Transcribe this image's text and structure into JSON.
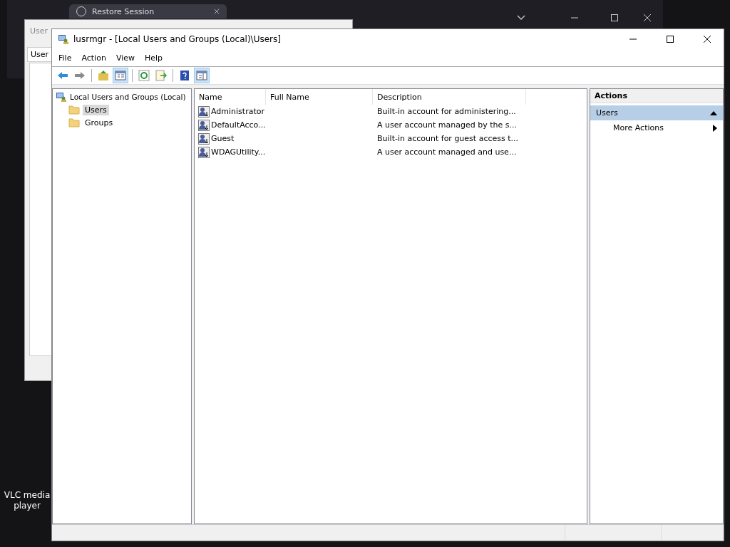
{
  "browser": {
    "tab": "Restore Session"
  },
  "back_dialog": {
    "title": "User",
    "tab": "User"
  },
  "desktop_icon": {
    "label": "VLC media player"
  },
  "window": {
    "title": "lusrmgr - [Local Users and Groups (Local)\\Users]"
  },
  "menu": [
    "File",
    "Action",
    "View",
    "Help"
  ],
  "toolbar": [
    {
      "kind": "back",
      "selected": false
    },
    {
      "kind": "forward",
      "selected": false
    },
    {
      "kind": "sep"
    },
    {
      "kind": "up",
      "selected": false
    },
    {
      "kind": "tree",
      "selected": true
    },
    {
      "kind": "sep"
    },
    {
      "kind": "refresh",
      "selected": false
    },
    {
      "kind": "export",
      "selected": false
    },
    {
      "kind": "sep"
    },
    {
      "kind": "help",
      "selected": false
    },
    {
      "kind": "pane",
      "selected": true
    }
  ],
  "tree": {
    "label": "Local Users and Groups (Local)",
    "children": [
      {
        "label": "Users",
        "selected": true
      },
      {
        "label": "Groups",
        "selected": false
      }
    ]
  },
  "table": {
    "columns": [
      "Name",
      "Full Name",
      "Description"
    ],
    "rows": [
      [
        "Administrator",
        "",
        "Built-in account for administering..."
      ],
      [
        "DefaultAcco...",
        "",
        "A user account managed by the s..."
      ],
      [
        "Guest",
        "",
        "Built-in account for guest access t..."
      ],
      [
        "WDAGUtility...",
        "",
        "A user account managed and use..."
      ]
    ]
  },
  "actions": {
    "title": "Actions",
    "section": {
      "label": "Users",
      "expanded": true
    },
    "items": [
      "More Actions"
    ]
  }
}
